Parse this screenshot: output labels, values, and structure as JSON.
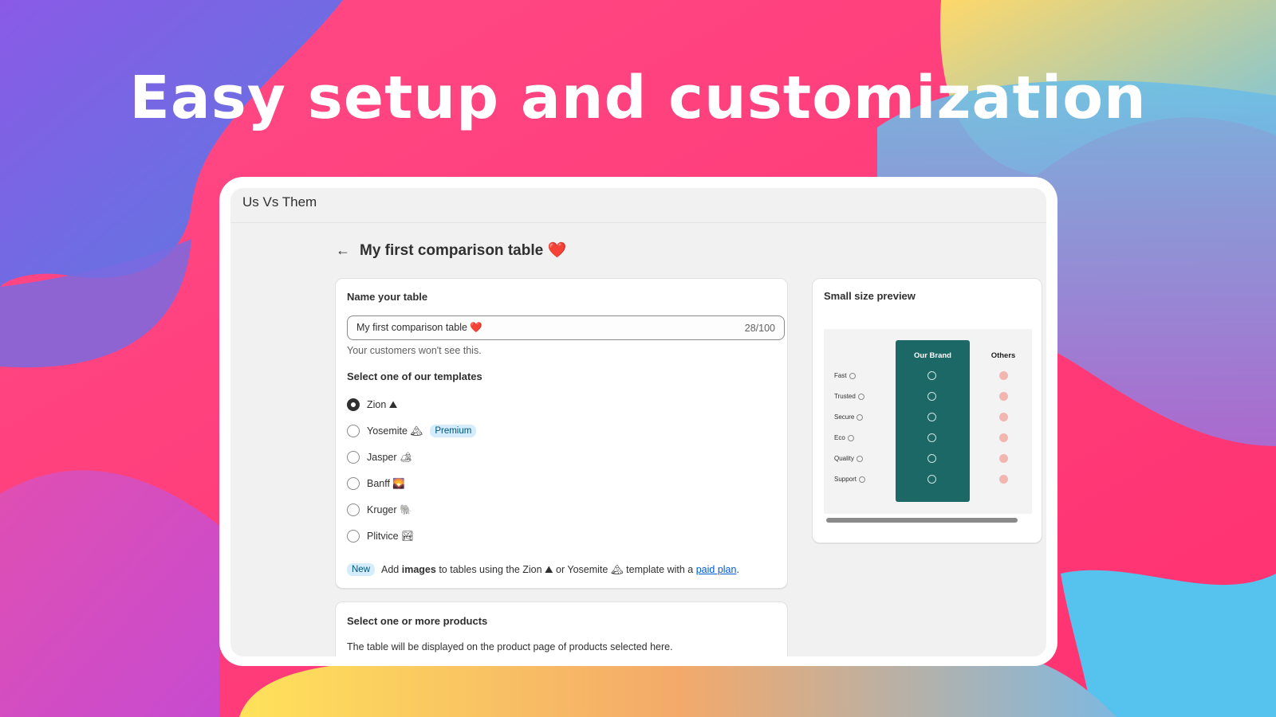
{
  "hero": {
    "title": "Easy setup and customization"
  },
  "app": {
    "name": "Us Vs Them"
  },
  "page": {
    "title": "My first comparison table ❤️"
  },
  "name_card": {
    "title": "Name your table",
    "input_value": "My first comparison table ❤️",
    "counter": "28/100",
    "helper": "Your customers won't see this."
  },
  "templates": {
    "title": "Select one of our templates",
    "options": [
      {
        "label": "Zion ⛰",
        "selected": true
      },
      {
        "label": "Yosemite 🏔",
        "selected": false,
        "badge": "Premium"
      },
      {
        "label": "Jasper 🏕",
        "selected": false
      },
      {
        "label": "Banff 🌄",
        "selected": false
      },
      {
        "label": "Kruger 🐘",
        "selected": false
      },
      {
        "label": "Plitvice 🏞",
        "selected": false
      }
    ]
  },
  "notice": {
    "badge": "New",
    "text_1": "Add",
    "text_bold": "images",
    "text_2": "to tables using the Zion ⛰ or Yosemite 🏔 template with a",
    "link": "paid plan",
    "text_3": "."
  },
  "preview": {
    "title": "Small size preview",
    "brand_header": "Our Brand",
    "others_header": "Others",
    "features": [
      "Fast",
      "Trusted",
      "Secure",
      "Eco",
      "Quality",
      "Support"
    ]
  },
  "products_card": {
    "title": "Select one or more products",
    "text": "The table will be displayed on the product page of products selected here."
  },
  "colors": {
    "brand_column": "#1b6866",
    "badge_bg": "#d4ecfb",
    "link": "#005bd3"
  }
}
